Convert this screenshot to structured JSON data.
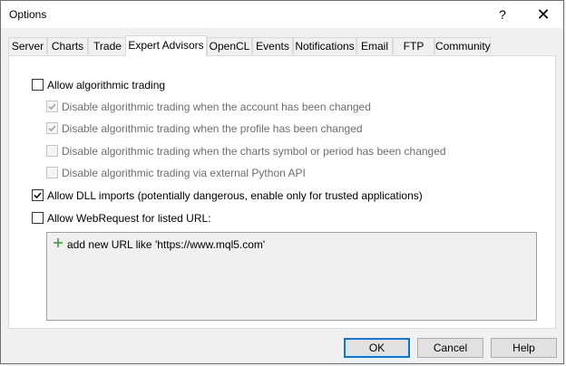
{
  "window": {
    "title": "Options",
    "help_glyph": "?",
    "close_glyph": "✕"
  },
  "tabs": [
    {
      "label": "Server"
    },
    {
      "label": "Charts"
    },
    {
      "label": "Trade"
    },
    {
      "label": "Expert Advisors",
      "active": true
    },
    {
      "label": "OpenCL"
    },
    {
      "label": "Events"
    },
    {
      "label": "Notifications"
    },
    {
      "label": "Email"
    },
    {
      "label": "FTP"
    },
    {
      "label": "Community"
    }
  ],
  "options": {
    "allow_algo": {
      "label": "Allow algorithmic trading",
      "checked": false,
      "enabled": true
    },
    "disable_account": {
      "label": "Disable algorithmic trading when the account has been changed",
      "checked": true,
      "enabled": false
    },
    "disable_profile": {
      "label": "Disable algorithmic trading when the profile has been changed",
      "checked": true,
      "enabled": false
    },
    "disable_symbol": {
      "label": "Disable algorithmic trading when the charts symbol or period has been changed",
      "checked": false,
      "enabled": false
    },
    "disable_python": {
      "label": "Disable algorithmic trading via external Python API",
      "checked": false,
      "enabled": false
    },
    "allow_dll": {
      "label": "Allow DLL imports (potentially dangerous, enable only for trusted applications)",
      "checked": true,
      "enabled": true
    },
    "allow_webrequest": {
      "label": "Allow WebRequest for listed URL:",
      "checked": false,
      "enabled": true
    }
  },
  "url_list": {
    "add_label": "add new URL like 'https://www.mql5.com'",
    "icon": "plus-icon"
  },
  "buttons": {
    "ok": "OK",
    "cancel": "Cancel",
    "help": "Help"
  },
  "colors": {
    "accent": "#0078d7",
    "plus": "#2aa12a"
  }
}
